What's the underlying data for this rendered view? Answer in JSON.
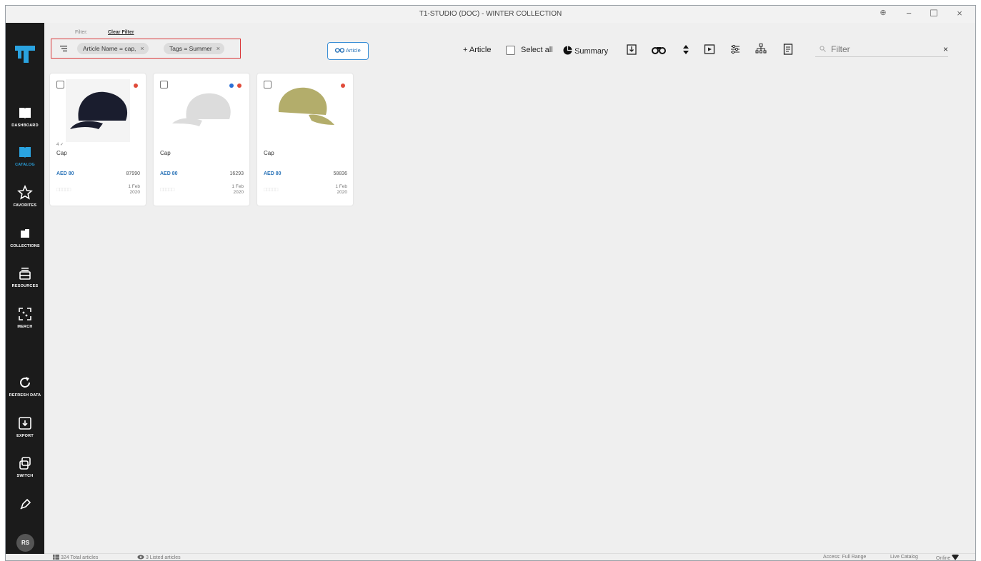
{
  "window": {
    "title": "T1-STUDIO (DOC) - WINTER COLLECTION",
    "controls": {
      "zoom": "⊕",
      "minimize": "−",
      "maximize": "☐",
      "close": "×"
    }
  },
  "sidebar": {
    "items": [
      {
        "label": "DASHBOARD",
        "icon": "dashboard-book-icon"
      },
      {
        "label": "CATALOG",
        "icon": "catalog-book-icon",
        "active": true
      },
      {
        "label": "FAVORITES",
        "icon": "star-icon"
      },
      {
        "label": "COLLECTIONS",
        "icon": "collections-folder-icon"
      },
      {
        "label": "RESOURCES",
        "icon": "resources-tray-icon"
      },
      {
        "label": "MERCH",
        "icon": "merch-frame-icon"
      },
      {
        "label": "REFRESH DATA",
        "icon": "refresh-icon"
      },
      {
        "label": "EXPORT",
        "icon": "export-icon"
      },
      {
        "label": "SWITCH",
        "icon": "switch-icon"
      }
    ],
    "notifications_icon": "bell-icon",
    "user_initials": "RS"
  },
  "filter": {
    "label": "Filter:",
    "clear_label": "Clear Filter",
    "chips": [
      {
        "text": "Article Name = cap,"
      },
      {
        "text": "Tags = Summer"
      }
    ],
    "chip_remove": "×"
  },
  "view_toggle": {
    "label": "Article"
  },
  "toolbar": {
    "add_article": "+ Article",
    "select_all": "Select all",
    "summary": "Summary",
    "search_placeholder": "Filter",
    "search_clear": "×"
  },
  "cards": [
    {
      "badge": "4 ✓",
      "name": "Cap",
      "price": "AED 80",
      "number": "87990",
      "date_line1": "1 Feb",
      "date_line2": "2020",
      "rating": "□□□□□",
      "dots": [
        "#e04b3a"
      ],
      "color": "#1a1d2e"
    },
    {
      "badge": "",
      "name": "Cap",
      "price": "AED 80",
      "number": "16293",
      "date_line1": "1 Feb",
      "date_line2": "2020",
      "rating": "□□□□□",
      "dots": [
        "#2a6fd6",
        "#e04b3a"
      ],
      "color": "#dcdcdc"
    },
    {
      "badge": "",
      "name": "Cap",
      "price": "AED 80",
      "number": "58836",
      "date_line1": "1 Feb",
      "date_line2": "2020",
      "rating": "□□□□□",
      "dots": [
        "#e04b3a"
      ],
      "color": "#b3ad6b"
    }
  ],
  "status": {
    "total": "324 Total articles",
    "listed": "3 Listed articles",
    "access": "Access: Full Range",
    "catalog": "Live Catalog",
    "online": "Online"
  },
  "colors": {
    "accent": "#2aa3e0",
    "sidebar_bg": "#1b1b1b",
    "filter_highlight": "#d9383a",
    "price_blue": "#2b74b8"
  }
}
